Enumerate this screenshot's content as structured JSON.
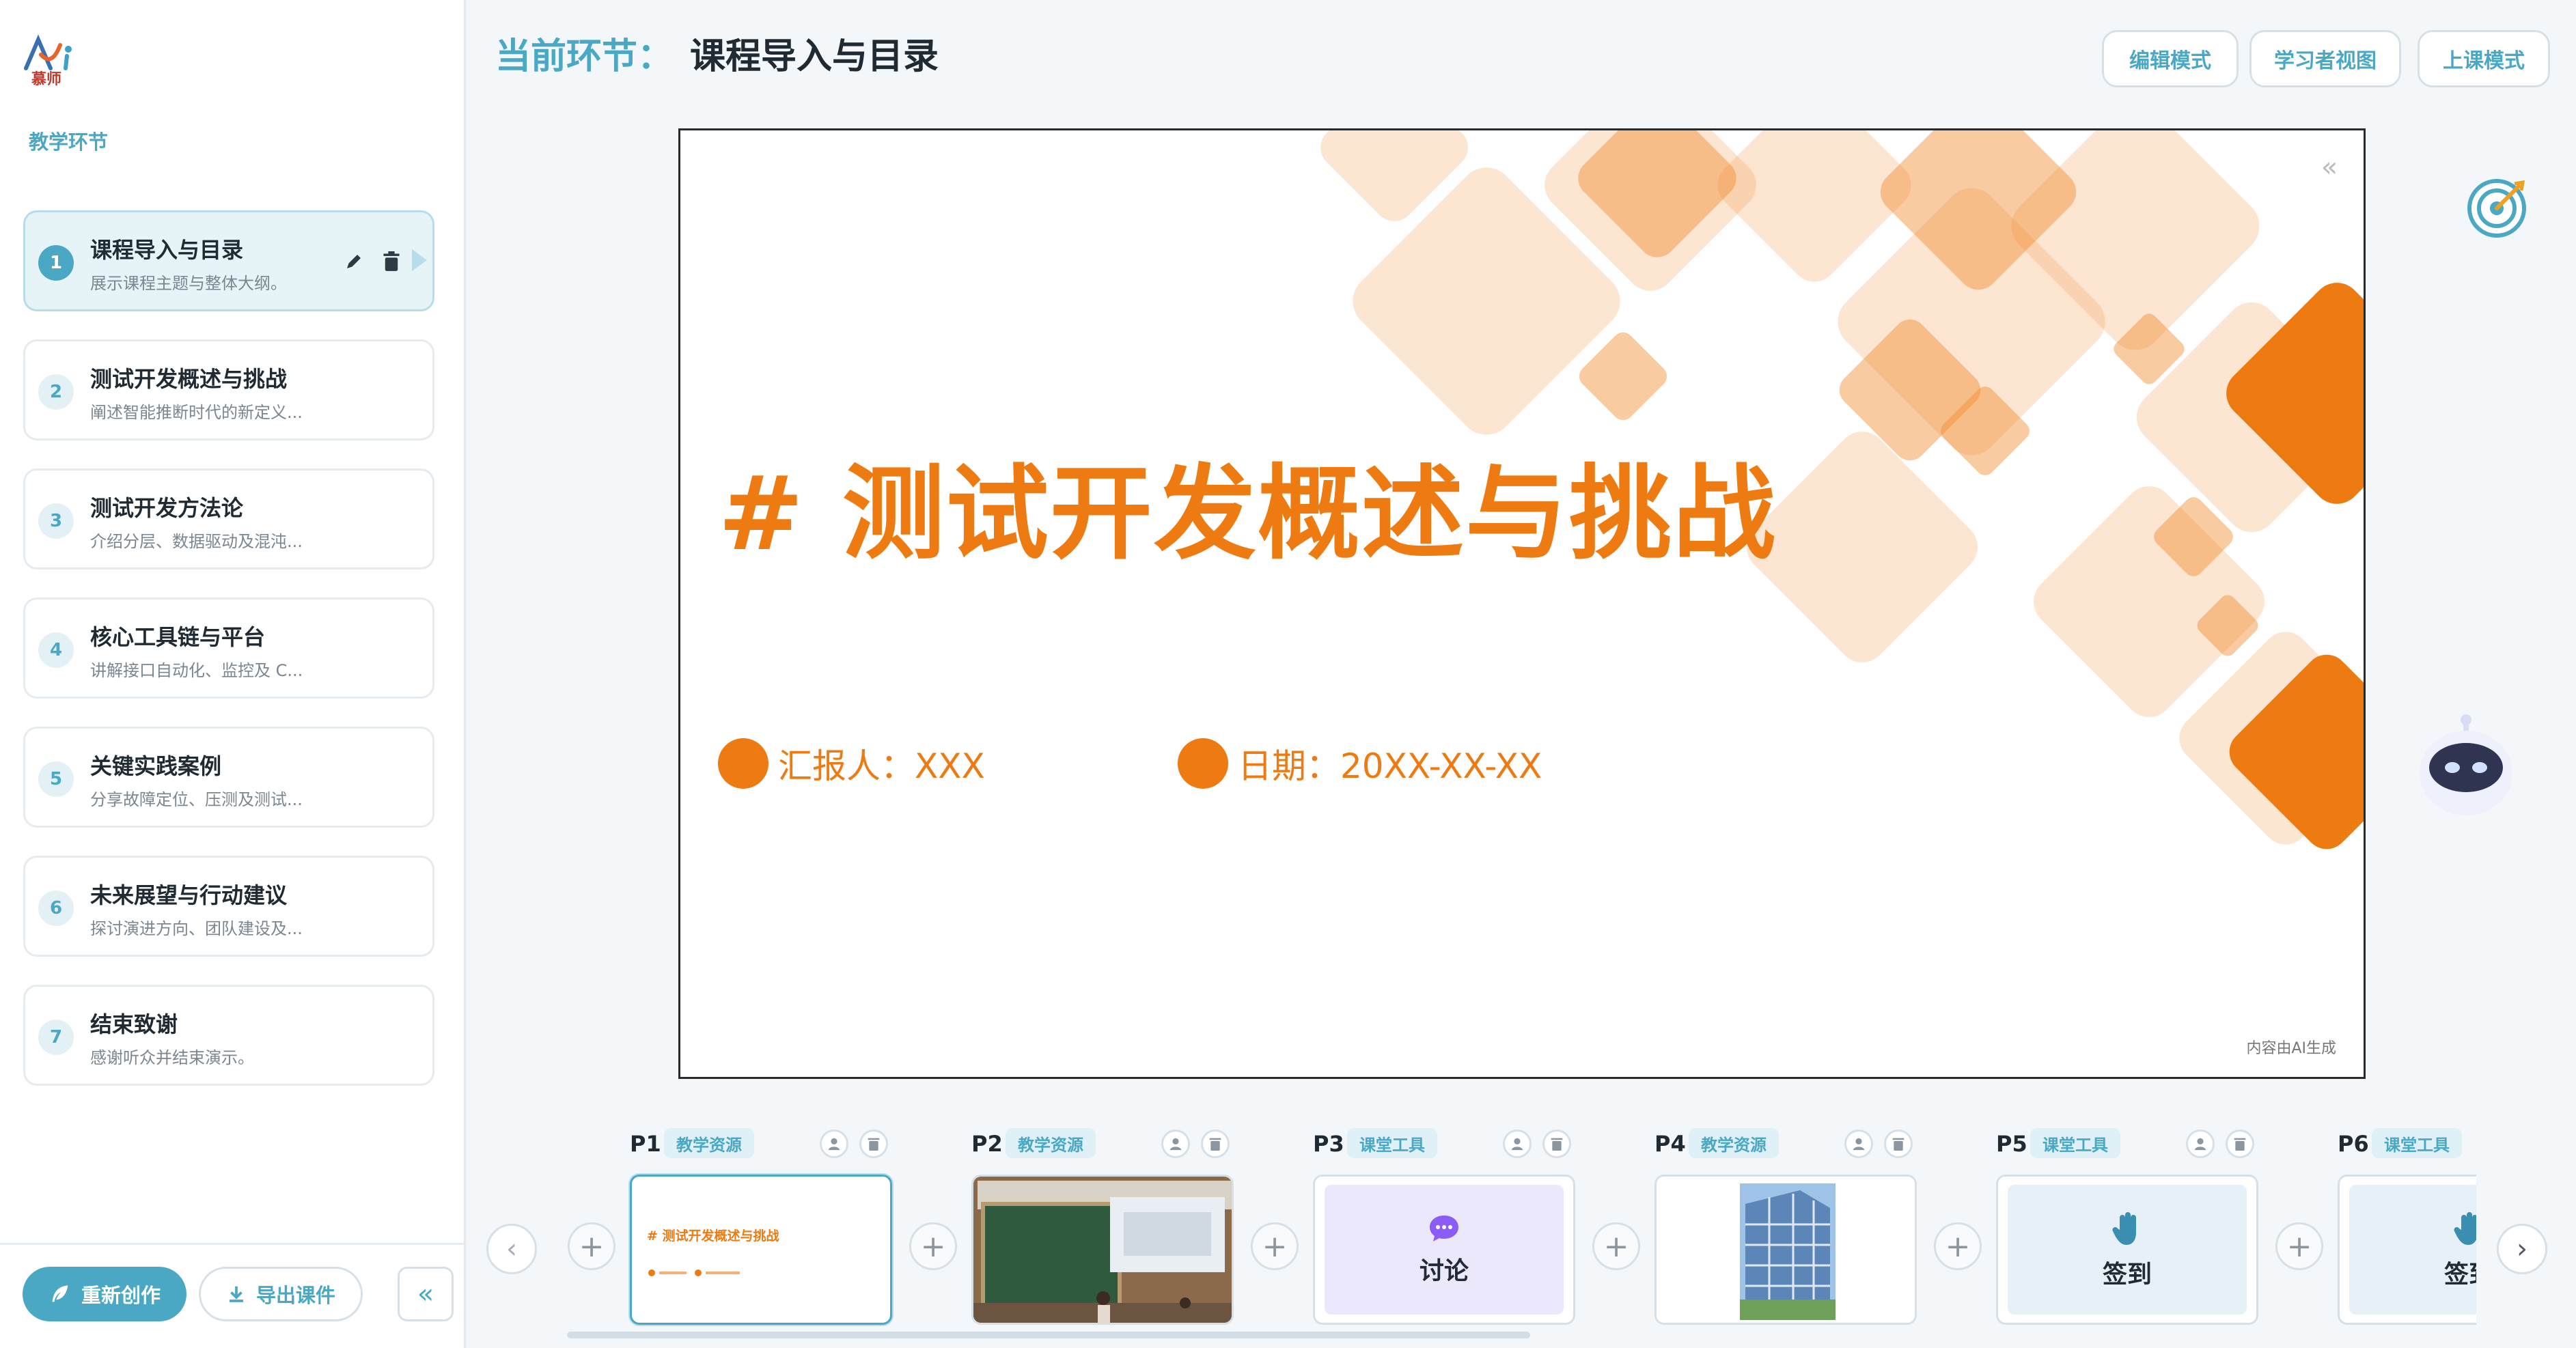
{
  "logo": {
    "brand_text": "慕师"
  },
  "sidebar": {
    "section_label": "教学环节",
    "steps": [
      {
        "num": "1",
        "title": "课程导入与目录",
        "desc": "展示课程主题与整体大纲。"
      },
      {
        "num": "2",
        "title": "测试开发概述与挑战",
        "desc": "阐述智能推断时代的新定义..."
      },
      {
        "num": "3",
        "title": "测试开发方法论",
        "desc": "介绍分层、数据驱动及混沌..."
      },
      {
        "num": "4",
        "title": "核心工具链与平台",
        "desc": "讲解接口自动化、监控及 C..."
      },
      {
        "num": "5",
        "title": "关键实践案例",
        "desc": "分享故障定位、压测及测试..."
      },
      {
        "num": "6",
        "title": "未来展望与行动建议",
        "desc": "探讨演进方向、团队建设及..."
      },
      {
        "num": "7",
        "title": "结束致谢",
        "desc": "感谢听众并结束演示。"
      }
    ],
    "recreate_label": "重新创作",
    "export_label": "导出课件",
    "collapse_icon": "«"
  },
  "header": {
    "label": "当前环节：",
    "title": "课程导入与目录",
    "buttons": [
      "编辑模式",
      "学习者视图",
      "上课模式"
    ]
  },
  "slide": {
    "title": "# 测试开发概述与挑战",
    "reporter": "汇报人：XXX",
    "date": "日期：20XX-XX-XX",
    "ai_note": "内容由AI生成",
    "collapse_icon": "«",
    "accent": "#ee7a12"
  },
  "filmstrip": {
    "cards": [
      {
        "label": "P1",
        "tag": "教学资源",
        "kind": "slide",
        "thumb_title": "# 测试开发概述与挑战"
      },
      {
        "label": "P2",
        "tag": "教学资源",
        "kind": "photo"
      },
      {
        "label": "P3",
        "tag": "课堂工具",
        "kind": "tool",
        "tool_label": "讨论",
        "icon": "chat-bubble-icon"
      },
      {
        "label": "P4",
        "tag": "教学资源",
        "kind": "building"
      },
      {
        "label": "P5",
        "tag": "课堂工具",
        "kind": "tool",
        "tool_label": "签到",
        "icon": "hand-icon"
      },
      {
        "label": "P6",
        "tag": "课堂工具",
        "kind": "tool",
        "tool_label": "签到",
        "icon": "hand-icon"
      }
    ],
    "prev_icon": "‹",
    "next_icon": "›",
    "add_icon": "+"
  },
  "colors": {
    "primary": "#4aa8c4",
    "accent": "#ee7a12",
    "tool_purple": "#ece8fb",
    "tool_blue": "#e5f0f7"
  }
}
